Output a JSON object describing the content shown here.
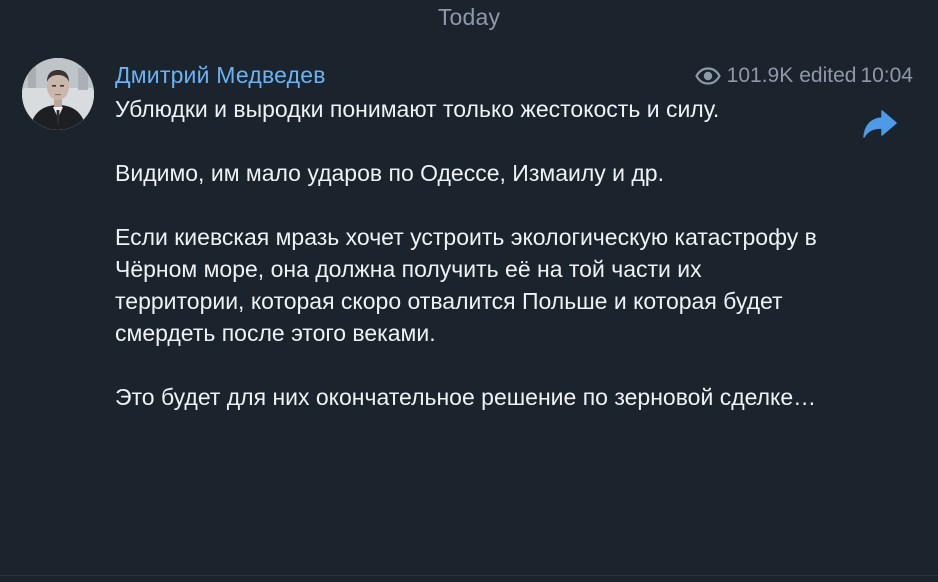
{
  "date_divider": "Today",
  "message": {
    "author": "Дмитрий Медведев",
    "views": "101.9K",
    "edited_label": "edited",
    "time": "10:04",
    "paragraphs": [
      "Ублюдки и выродки понимают только жестокость и силу.",
      "Видимо, им мало ударов по Одессе, Измаилу и др.",
      "Если киевская мразь хочет устроить экологическую катастрофу в Чёрном море, она должна получить её на той части их территории, которая скоро отвалится Польше и которая будет смердеть после этого веками.",
      "Это будет для них окончательное решение по зерновой сделке…"
    ]
  },
  "icons": {
    "views": "eye-icon",
    "forward": "share-arrow-icon",
    "avatar": "user-photo"
  },
  "colors": {
    "background": "#1b232d",
    "author": "#6ab2f2",
    "text": "#eef2f6",
    "meta": "#8e9aa8",
    "forward_icon": "#4f9ae6"
  }
}
